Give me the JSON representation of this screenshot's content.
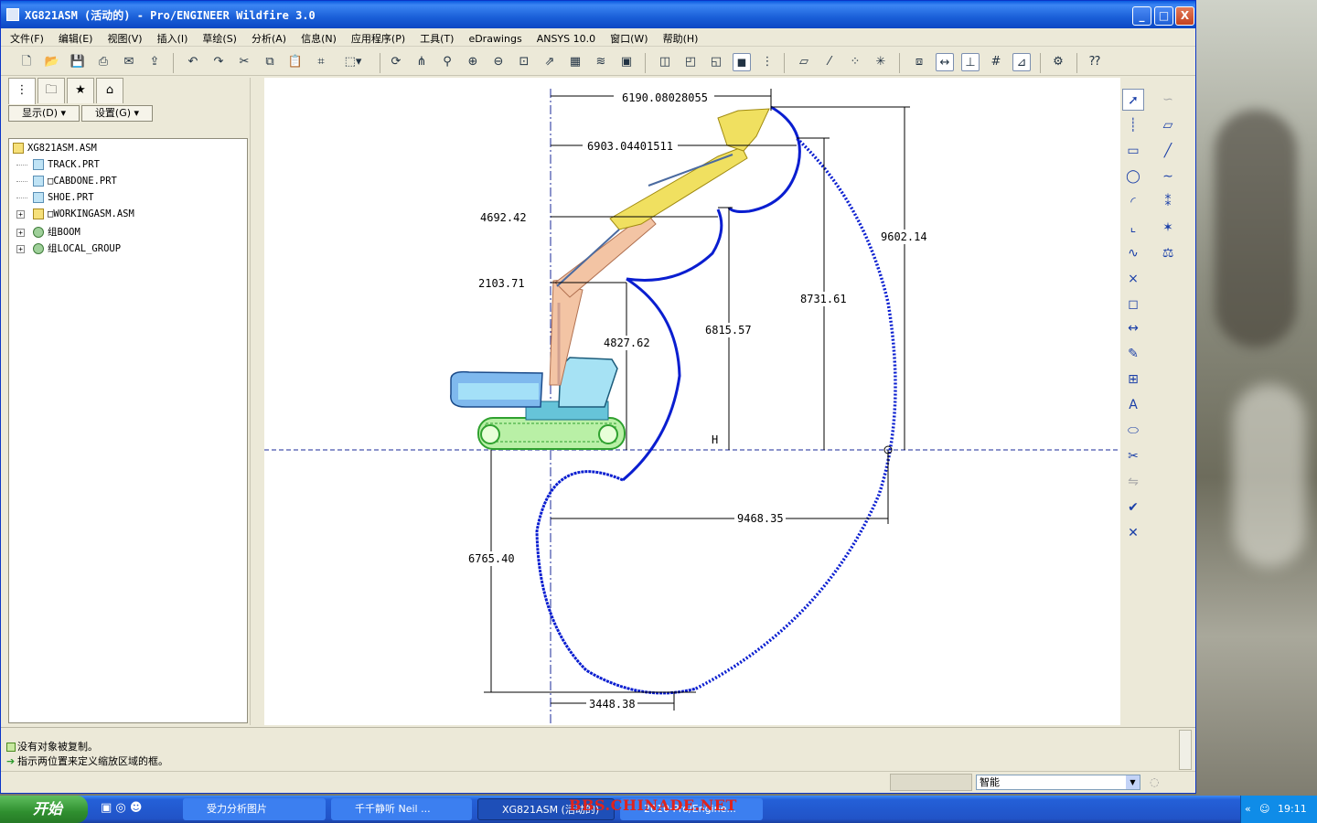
{
  "window": {
    "title": "XG821ASM (活动的) - Pro/ENGINEER Wildfire 3.0",
    "min": "_",
    "max": "□",
    "close": "X"
  },
  "menu": [
    "文件(F)",
    "编辑(E)",
    "视图(V)",
    "插入(I)",
    "草绘(S)",
    "分析(A)",
    "信息(N)",
    "应用程序(P)",
    "工具(T)",
    "eDrawings",
    "ANSYS 10.0",
    "窗口(W)",
    "帮助(H)"
  ],
  "nav": {
    "show_btn": "显示(D) ▾",
    "settings_btn": "设置(G) ▾",
    "tree": [
      {
        "label": "XG821ASM.ASM",
        "type": "asm",
        "level": 0,
        "expandable": false
      },
      {
        "label": "TRACK.PRT",
        "type": "prt",
        "level": 1,
        "expandable": false
      },
      {
        "label": "□CABDONE.PRT",
        "type": "prt",
        "level": 1,
        "expandable": false
      },
      {
        "label": "SHOE.PRT",
        "type": "prt",
        "level": 1,
        "expandable": false
      },
      {
        "label": "□WORKINGASM.ASM",
        "type": "asm",
        "level": 1,
        "expandable": true
      },
      {
        "label": "组BOOM",
        "type": "grp",
        "level": 1,
        "expandable": true
      },
      {
        "label": "组LOCAL_GROUP",
        "type": "grp",
        "level": 1,
        "expandable": true
      }
    ]
  },
  "dimensions": {
    "d1": "6190.08028055",
    "d2": "6903.04401511",
    "d3": "4692.42",
    "d4": "2103.71",
    "d5": "4827.62",
    "d6": "6815.57",
    "d7": "8731.61",
    "d8": "9602.14",
    "d9": "9468.35",
    "d10": "6765.40",
    "d11": "3448.38",
    "h_label": "H"
  },
  "messages": {
    "line1": "没有对象被复制。",
    "line2": "指示两位置来定义缩放区域的框。"
  },
  "status": {
    "filter": "智能"
  },
  "taskbar": {
    "start": "开始",
    "tasks": [
      "受力分析图片",
      "千千静听  Neil ...",
      "XG821ASM (活动的)",
      "2010·Pro/Engine..."
    ],
    "clock": "19:11",
    "watermark": "BBS.CHINADE.NET"
  },
  "colors": {
    "title_blue": "#0b47c4",
    "envelope_blue": "#0a1ed0",
    "boom_yellow": "#f0e060",
    "arm_salmon": "#f3c4a4",
    "track_green": "#6ad35a"
  }
}
